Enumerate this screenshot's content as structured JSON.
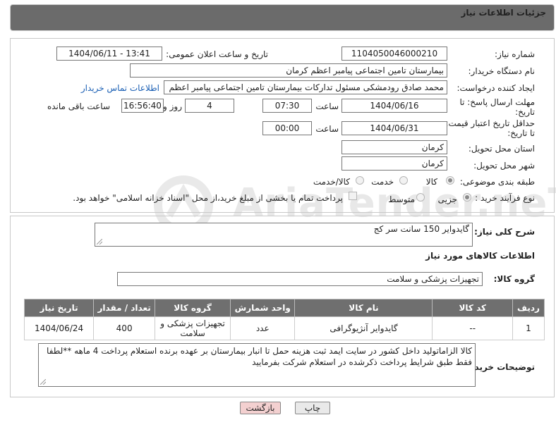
{
  "header": {
    "title": "جزئیات اطلاعات نیاز"
  },
  "watermark": "AriaTender.neT",
  "form": {
    "need_number_label": "شماره نیاز:",
    "need_number": "1104050046000210",
    "announce_label": "تاریخ و ساعت اعلان عمومی:",
    "announce_value": "1404/06/11 - 13:41",
    "buyer_org_label": "نام دستگاه خریدار:",
    "buyer_org": "بیمارستان تامین اجتماعی پیامبر اعظم کرمان",
    "creator_label": "ایجاد کننده درخواست:",
    "creator": "محمد صادق  رودمشکی مسئول تدارکات بیمارستان تامین اجتماعی پیامبر اعظم",
    "contact_link": "اطلاعات تماس خریدار",
    "deadline_label_1": "مهلت ارسال پاسخ: تا",
    "deadline_label_2": "تاریخ:",
    "deadline_date": "1404/06/16",
    "time_label": "ساعت",
    "deadline_time": "07:30",
    "days_value": "4",
    "days_label": "روز و",
    "remaining_time": "16:56:40",
    "remaining_label": "ساعت باقی مانده",
    "validity_label_1": "حداقل تاریخ اعتبار قیمت:",
    "validity_label_2": "تا تاریخ:",
    "validity_date": "1404/06/31",
    "validity_time": "00:00",
    "province_label": "استان محل تحویل:",
    "province": "کرمان",
    "city_label": "شهر محل تحویل:",
    "city": "کرمان",
    "category_label": "طبقه بندی موضوعی:",
    "category_options": [
      "کالا",
      "خدمت",
      "کالا/خدمت"
    ],
    "category_selected": "کالا",
    "process_label": "نوع فرآیند خرید :",
    "process_options": [
      "جزیی",
      "متوسط"
    ],
    "process_selected": "جزیی",
    "payment_note": "پرداخت تمام یا بخشی از مبلغ خرید،از محل \"اسناد خزانه اسلامی\" خواهد بود."
  },
  "details": {
    "summary_label": "شرح کلی نیاز:",
    "summary": "گایدوایر 150 سانت سر کج",
    "goods_info_title": "اطلاعات کالاهای مورد نیاز",
    "goods_group_label": "گروه کالا:",
    "goods_group": "تجهیزات پزشکی و سلامت",
    "table_headers": [
      "ردیف",
      "کد کالا",
      "نام کالا",
      "واحد شمارش",
      "گروه کالا",
      "تعداد / مقدار",
      "تاریخ نیاز"
    ],
    "rows": [
      {
        "row": "1",
        "code": "--",
        "name": "گایدوایر آنژیوگرافی",
        "unit": "عدد",
        "group": "تجهیزات پزشکی و سلامت",
        "qty": "400",
        "date": "1404/06/24"
      }
    ],
    "buyer_notes_label": "توضیحات خریدار:",
    "buyer_notes_line1": "کالا الزاماتولید داخل کشور در سایت ایمد ثبت هزینه حمل تا انبار بیمارستان بر عهده برنده استعلام پرداخت 4 ماهه **لطفا",
    "buyer_notes_line2": "فقط طبق شرایط پرداخت ذکرشده در استعلام شرکت بفرمایید"
  },
  "buttons": {
    "print": "چاپ",
    "back": "بازگشت"
  }
}
